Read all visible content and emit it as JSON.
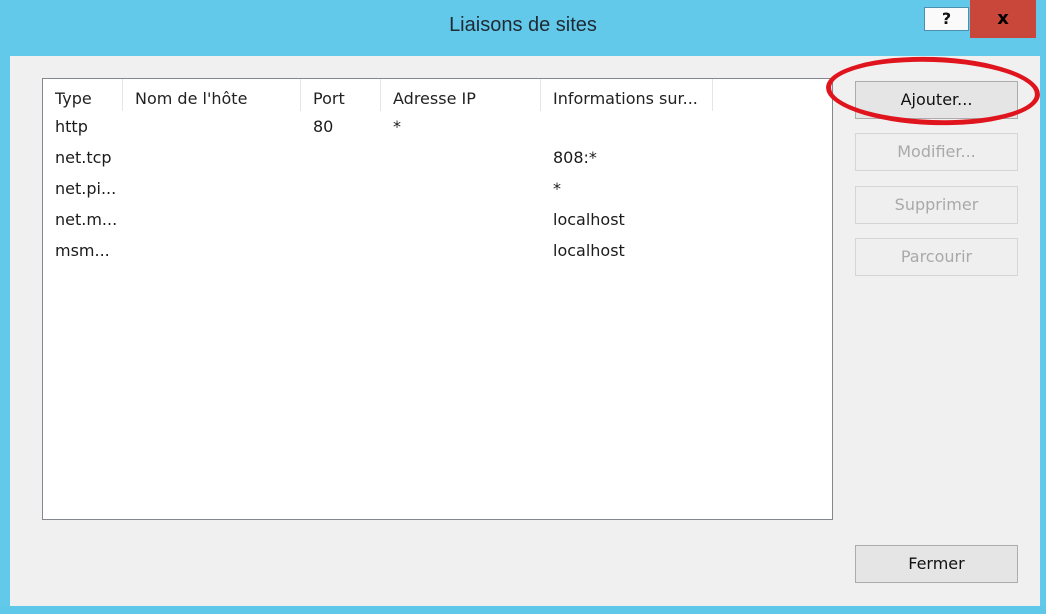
{
  "window": {
    "title": "Liaisons de sites",
    "help_label": "?",
    "close_label": "x"
  },
  "list": {
    "columns": [
      "Type",
      "Nom de l'hôte",
      "Port",
      "Adresse IP",
      "Informations sur..."
    ],
    "rows": [
      [
        "http",
        "",
        "80",
        "*",
        ""
      ],
      [
        "net.tcp",
        "",
        "",
        "",
        "808:*"
      ],
      [
        "net.pi...",
        "",
        "",
        "",
        "*"
      ],
      [
        "net.m...",
        "",
        "",
        "",
        "localhost"
      ],
      [
        "msm...",
        "",
        "",
        "",
        "localhost"
      ]
    ]
  },
  "buttons": {
    "add": "Ajouter...",
    "edit": "Modifier...",
    "remove": "Supprimer",
    "browse": "Parcourir",
    "close": "Fermer"
  },
  "colors": {
    "title_bar": "#63c9ea",
    "close_button": "#c8473a",
    "highlight_ellipse": "#e0141d"
  }
}
